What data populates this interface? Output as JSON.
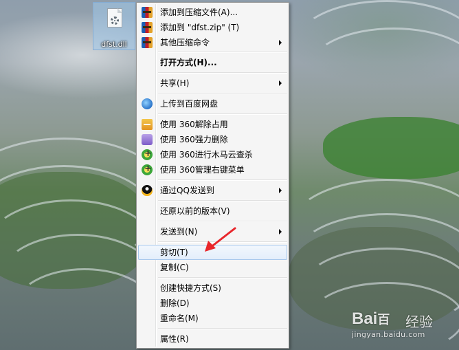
{
  "desktop": {
    "file": {
      "name": "dfst.dll",
      "icon": "dll-file-icon"
    }
  },
  "context_menu": {
    "items": [
      {
        "label": "添加到压缩文件(A)...",
        "icon": "winrar-icon",
        "submenu": false,
        "bold": false
      },
      {
        "label": "添加到 \"dfst.zip\" (T)",
        "icon": "winrar-icon",
        "submenu": false,
        "bold": false
      },
      {
        "label": "其他压缩命令",
        "icon": "winrar-icon",
        "submenu": true,
        "bold": false
      },
      {
        "label": "打开方式(H)...",
        "icon": "",
        "submenu": false,
        "bold": true
      },
      {
        "label": "共享(H)",
        "icon": "",
        "submenu": true,
        "bold": false
      },
      {
        "label": "上传到百度网盘",
        "icon": "baidu-netdisk-icon",
        "submenu": false,
        "bold": false
      },
      {
        "label": "使用 360解除占用",
        "icon": "360-unlock-icon",
        "submenu": false,
        "bold": false
      },
      {
        "label": "使用 360强力删除",
        "icon": "360-shred-icon",
        "submenu": false,
        "bold": false
      },
      {
        "label": "使用 360进行木马云查杀",
        "icon": "360-scan-icon",
        "submenu": false,
        "bold": false
      },
      {
        "label": "使用 360管理右键菜单",
        "icon": "360-manage-icon",
        "submenu": false,
        "bold": false
      },
      {
        "label": "通过QQ发送到",
        "icon": "qq-penguin-icon",
        "submenu": true,
        "bold": false
      },
      {
        "label": "还原以前的版本(V)",
        "icon": "",
        "submenu": false,
        "bold": false
      },
      {
        "label": "发送到(N)",
        "icon": "",
        "submenu": true,
        "bold": false
      },
      {
        "label": "剪切(T)",
        "icon": "",
        "submenu": false,
        "bold": false,
        "highlighted": true
      },
      {
        "label": "复制(C)",
        "icon": "",
        "submenu": false,
        "bold": false
      },
      {
        "label": "创建快捷方式(S)",
        "icon": "",
        "submenu": false,
        "bold": false
      },
      {
        "label": "删除(D)",
        "icon": "",
        "submenu": false,
        "bold": false
      },
      {
        "label": "重命名(M)",
        "icon": "",
        "submenu": false,
        "bold": false
      },
      {
        "label": "属性(R)",
        "icon": "",
        "submenu": false,
        "bold": false
      }
    ]
  },
  "annotation": {
    "arrow_color": "#e8262b"
  },
  "watermark": {
    "logo": "Bai",
    "logo_tail": "百",
    "text": "经验",
    "url": "jingyan.baidu.com"
  }
}
